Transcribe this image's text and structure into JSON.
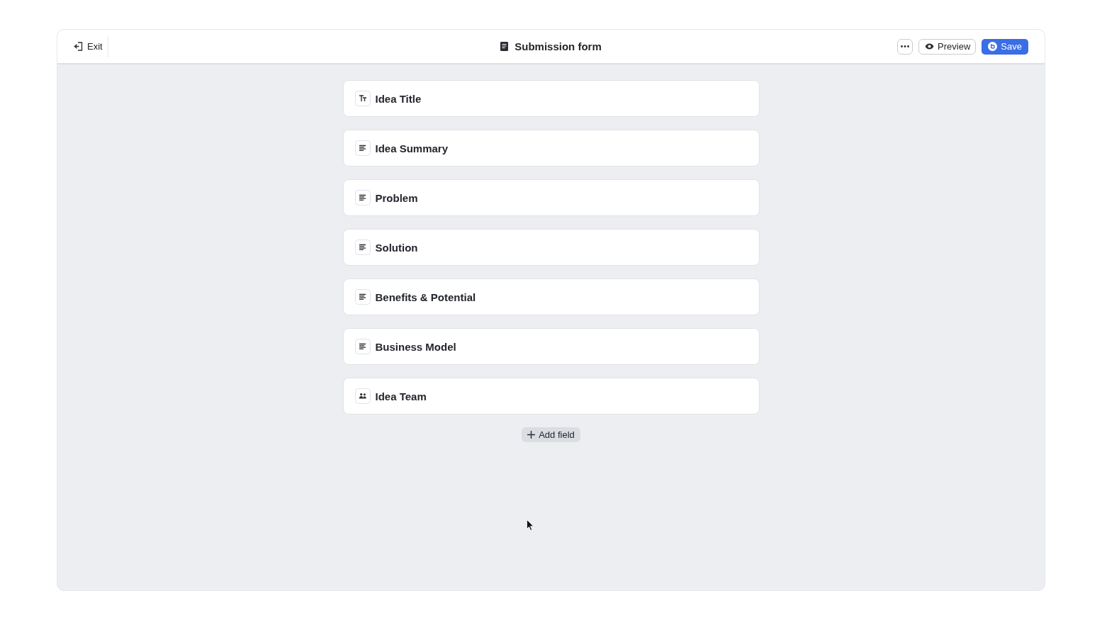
{
  "header": {
    "exit": {
      "label": "Exit"
    },
    "title": "Submission form",
    "actions": [
      {
        "kind": "more"
      },
      {
        "kind": "preview",
        "label": "Preview"
      },
      {
        "kind": "save",
        "label": "Save"
      }
    ]
  },
  "fields": [
    {
      "kind": "text",
      "label": "Idea Title"
    },
    {
      "kind": "paragraph",
      "label": "Idea Summary"
    },
    {
      "kind": "paragraph",
      "label": "Problem"
    },
    {
      "kind": "paragraph",
      "label": "Solution"
    },
    {
      "kind": "paragraph",
      "label": "Benefits & Potential"
    },
    {
      "kind": "paragraph",
      "label": "Business Model"
    },
    {
      "kind": "team",
      "label": "Idea Team"
    }
  ],
  "add_field": {
    "label": "Add field"
  }
}
